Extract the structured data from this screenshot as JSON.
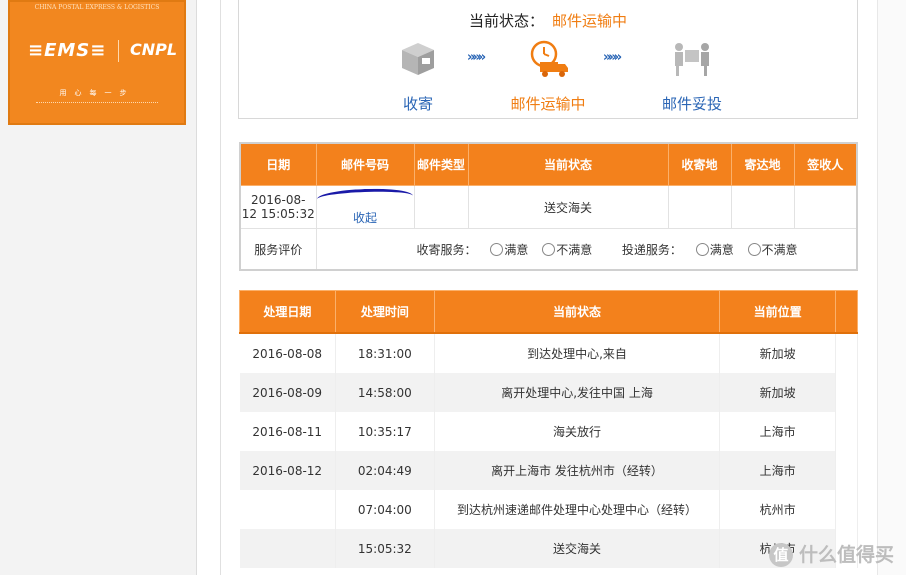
{
  "logo": {
    "tagline": "CHINA POSTAL EXPRESS & LOGISTICS",
    "brand_ems": "≡EMS≡",
    "brand_cnpl": "CNPL",
    "slogan": "用心每一步"
  },
  "status": {
    "label": "当前状态：",
    "value": "邮件运输中",
    "steps": [
      {
        "label": "收寄",
        "icon": "package-icon"
      },
      {
        "label": "邮件运输中",
        "icon": "delivery-truck-icon"
      },
      {
        "label": "邮件妥投",
        "icon": "signed-delivery-icon"
      }
    ],
    "arrow": "»»»"
  },
  "info_table": {
    "headers": [
      "日期",
      "邮件号码",
      "邮件类型",
      "当前状态",
      "收寄地",
      "寄达地",
      "签收人"
    ],
    "row": {
      "date_line1": "2016-08-",
      "date_line2": "12 15:05:32",
      "collapse_link": "收起",
      "type": "",
      "current_status": "送交海关",
      "origin": "",
      "destination": "",
      "recipient": ""
    },
    "rating": {
      "label": "服务评价",
      "collect_label": "收寄服务：",
      "delivery_label": "投递服务：",
      "satisfied": "满意",
      "unsatisfied": "不满意"
    }
  },
  "track_table": {
    "headers": [
      "处理日期",
      "处理时间",
      "当前状态",
      "当前位置"
    ],
    "rows": [
      {
        "date": "2016-08-08",
        "time": "18:31:00",
        "status": "到达处理中心,来自",
        "location": "新加坡"
      },
      {
        "date": "2016-08-09",
        "time": "14:58:00",
        "status": "离开处理中心,发往中国 上海",
        "location": "新加坡"
      },
      {
        "date": "2016-08-11",
        "time": "10:35:17",
        "status": "海关放行",
        "location": "上海市"
      },
      {
        "date": "2016-08-12",
        "time": "02:04:49",
        "status": "离开上海市 发往杭州市（经转）",
        "location": "上海市"
      },
      {
        "date": "",
        "time": "07:04:00",
        "status": "到达杭州速递邮件处理中心处理中心（经转）",
        "location": "杭州市"
      },
      {
        "date": "",
        "time": "15:05:32",
        "status": "送交海关",
        "location": "杭州市"
      }
    ]
  },
  "watermark": {
    "glyph": "值",
    "text": "什么值得买"
  },
  "colors": {
    "accent": "#f3811c",
    "link": "#2a65b5",
    "status": "#f07d12"
  }
}
